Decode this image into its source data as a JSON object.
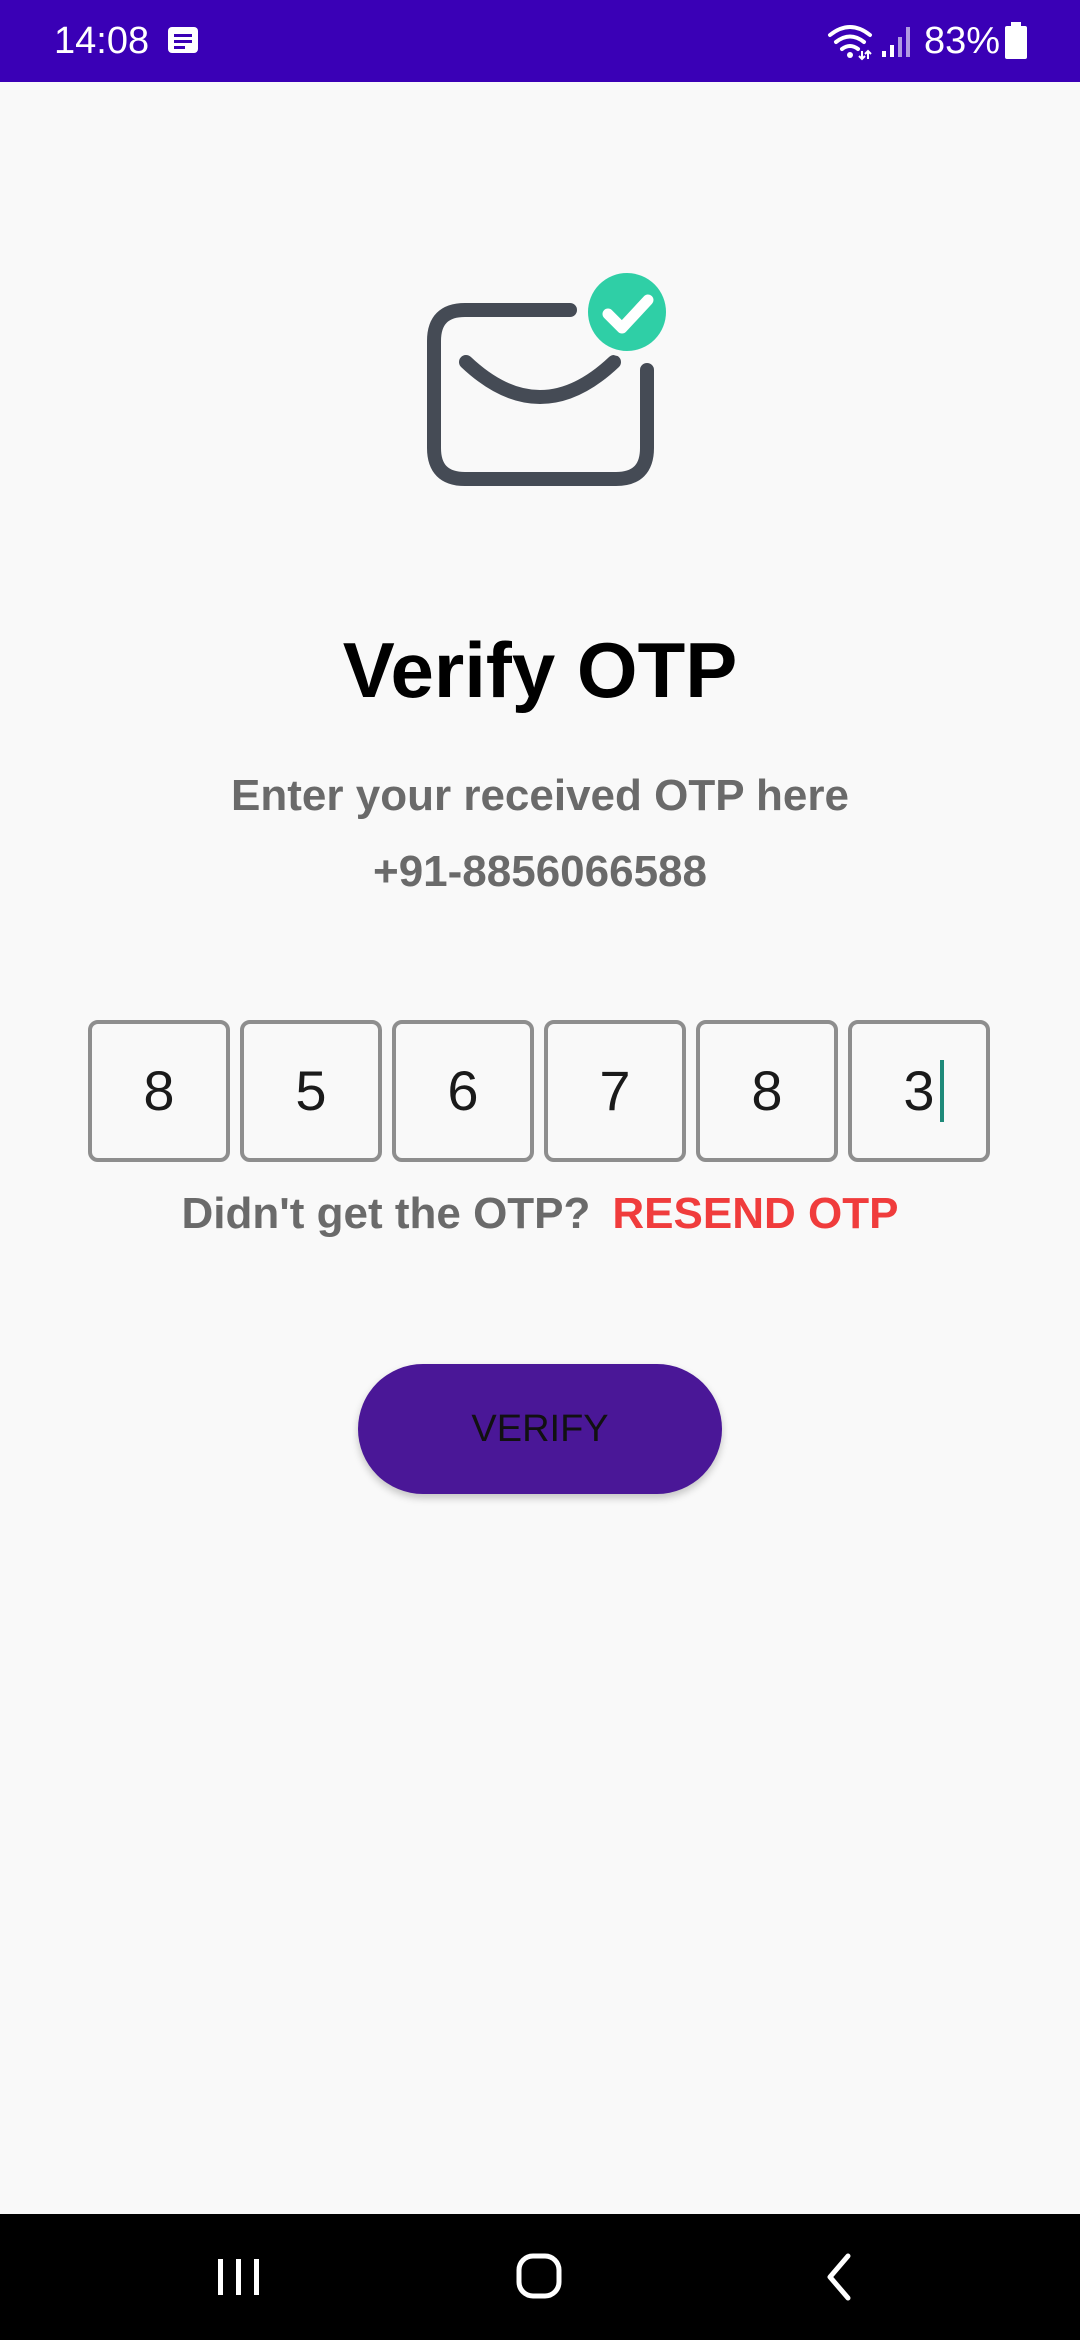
{
  "status_bar": {
    "time": "14:08",
    "message_icon": "message-notification-icon",
    "wifi_icon": "wifi-icon",
    "signal_icon": "cell-signal-icon",
    "battery_percent": "83%",
    "battery_icon": "battery-icon",
    "background": "#3a00b6"
  },
  "illustration": {
    "icon": "mail-verified-icon",
    "accent": "#2fcfa6",
    "stroke": "#454b55"
  },
  "page": {
    "title": "Verify OTP",
    "instruction": "Enter your received OTP here",
    "phone_number": "+91-8856066588"
  },
  "otp": {
    "digits": [
      "8",
      "5",
      "6",
      "7",
      "8",
      "3"
    ],
    "focused_index": 5
  },
  "resend": {
    "prompt": "Didn't get the OTP?",
    "link_label": "RESEND OTP",
    "link_color": "#f03c3c"
  },
  "verify_button": {
    "label": "VERIFY",
    "color": "#4a1797"
  },
  "nav_bar": {
    "recents_icon": "recent-apps-icon",
    "home_icon": "home-icon",
    "back_icon": "back-icon"
  }
}
